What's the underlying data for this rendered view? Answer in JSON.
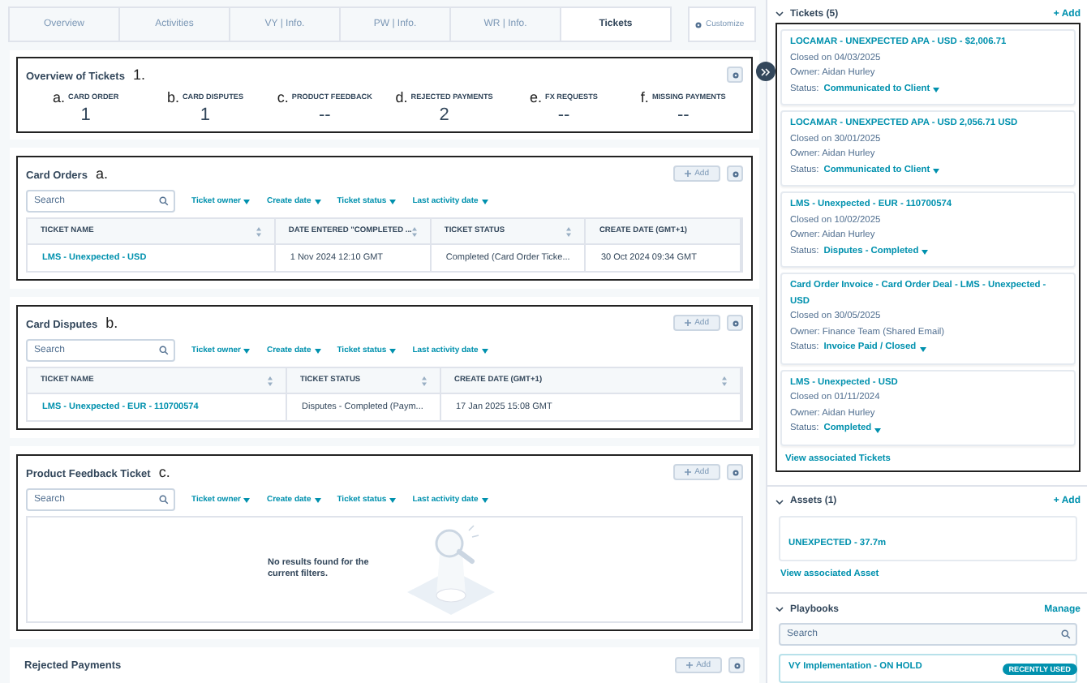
{
  "tabs": [
    {
      "label": "Overview",
      "selected": false
    },
    {
      "label": "Activities",
      "selected": false
    },
    {
      "label": "VY | Info.",
      "selected": false
    },
    {
      "label": "PW | Info.",
      "selected": false
    },
    {
      "label": "WR | Info.",
      "selected": false
    },
    {
      "label": "Tickets",
      "selected": true
    }
  ],
  "customize": {
    "label": "Customize"
  },
  "overview": {
    "title": "Overview of Tickets",
    "marker": "1.",
    "stats": [
      {
        "marker": "a.",
        "label": "CARD ORDER",
        "value": "1"
      },
      {
        "marker": "b.",
        "label": "CARD DISPUTES",
        "value": "1"
      },
      {
        "marker": "c.",
        "label": "PRODUCT FEEDBACK",
        "value": "--"
      },
      {
        "marker": "d.",
        "label": "REJECTED PAYMENTS",
        "value": "2"
      },
      {
        "marker": "e.",
        "label": "FX REQUESTS",
        "value": "--"
      },
      {
        "marker": "f.",
        "label": "MISSING PAYMENTS",
        "value": "--"
      }
    ]
  },
  "cards": [
    {
      "title": "Card Orders",
      "marker": "a.",
      "add": "Add",
      "search_placeholder": "Search",
      "filters": [
        "Ticket owner",
        "Create date",
        "Ticket status",
        "Last activity date"
      ],
      "columns": [
        {
          "label": "TICKET NAME",
          "sortable": true
        },
        {
          "label": "DATE ENTERED \"COMPLETED ...",
          "sortable": true
        },
        {
          "label": "TICKET STATUS",
          "sortable": true
        },
        {
          "label": "CREATE DATE (GMT+1)",
          "sortable": false
        }
      ],
      "rows": [
        [
          "LMS - Unexpected - USD",
          "1 Nov 2024 12:10 GMT",
          "Completed (Card Order Ticke...",
          "30 Oct 2024 09:34 GMT"
        ]
      ]
    },
    {
      "title": "Card Disputes",
      "marker": "b.",
      "add": "Add",
      "search_placeholder": "Search",
      "filters": [
        "Ticket owner",
        "Create date",
        "Ticket status",
        "Last activity date"
      ],
      "columns": [
        {
          "label": "TICKET NAME",
          "sortable": true
        },
        {
          "label": "TICKET STATUS",
          "sortable": true
        },
        {
          "label": "CREATE DATE (GMT+1)",
          "sortable": true
        }
      ],
      "rows": [
        [
          "LMS - Unexpected - EUR - 110700574",
          "Disputes - Completed (Paym...",
          "17 Jan 2025 15:08 GMT"
        ]
      ]
    },
    {
      "title": "Product Feedback Ticket",
      "marker": "c.",
      "add": "Add",
      "search_placeholder": "Search",
      "filters": [
        "Ticket owner",
        "Create date",
        "Ticket status",
        "Last activity date"
      ],
      "empty_message": "No results found for the current filters."
    }
  ],
  "partial_card": {
    "title": "Rejected Payments",
    "add": "Add"
  },
  "sidebar": {
    "tickets": {
      "title": "Tickets (5)",
      "add": "+ Add",
      "view_link": "View associated Tickets",
      "items": [
        {
          "title": "LOCAMAR - UNEXPECTED APA - USD - $2,006.71",
          "closed": "Closed on 04/03/2025",
          "owner": "Owner:  Aidan Hurley",
          "status_label": "Status:",
          "status": "Communicated to Client"
        },
        {
          "title": "LOCAMAR - UNEXPECTED APA - USD 2,056.71 USD",
          "closed": "Closed on 30/01/2025",
          "owner": "Owner:  Aidan Hurley",
          "status_label": "Status:",
          "status": "Communicated to Client"
        },
        {
          "title": "LMS - Unexpected - EUR - 110700574",
          "closed": "Closed on 10/02/2025",
          "owner": "Owner:  Aidan Hurley",
          "status_label": "Status:",
          "status": "Disputes - Completed"
        },
        {
          "title": "Card Order Invoice - Card Order Deal - LMS - Unexpected - USD",
          "closed": "Closed on 30/05/2025",
          "owner": "Owner:  Finance Team (Shared Email)",
          "status_label": "Status:",
          "status": "Invoice Paid / Closed"
        },
        {
          "title": "LMS - Unexpected - USD",
          "closed": "Closed on 01/11/2024",
          "owner": "Owner:  Aidan Hurley",
          "status_label": "Status:",
          "status": "Completed"
        }
      ]
    },
    "assets": {
      "title": "Assets (1)",
      "add": "+ Add",
      "view_link": "View associated Asset",
      "items": [
        "UNEXPECTED - 37.7m"
      ]
    },
    "playbooks": {
      "title": "Playbooks",
      "manage": "Manage",
      "search_placeholder": "Search",
      "items": [
        {
          "title": "VY Implementation - ON HOLD",
          "badge": "RECENTLY USED"
        }
      ]
    }
  }
}
